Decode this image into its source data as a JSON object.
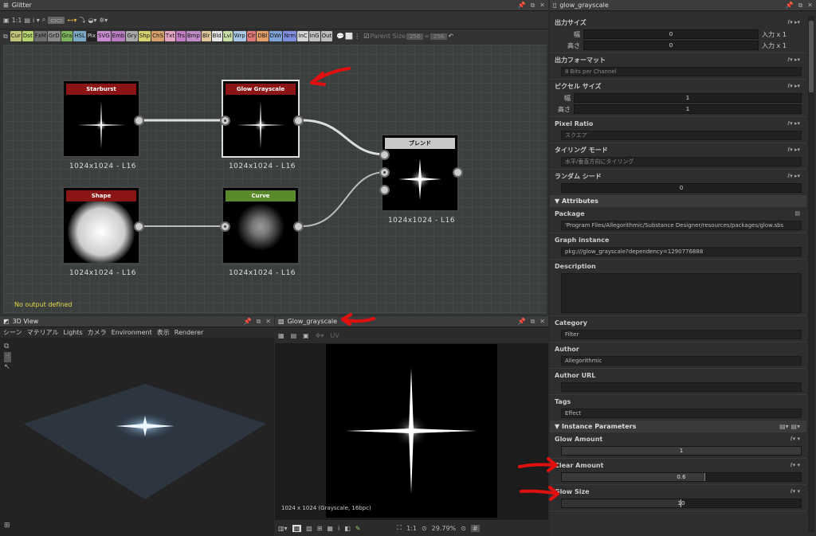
{
  "graph": {
    "title": "Glitter",
    "toolbar_zoom": "1:1",
    "library": [
      {
        "label": "Cur",
        "color": "#c3c37a"
      },
      {
        "label": "Dst",
        "color": "#b6d46e"
      },
      {
        "label": "FxM",
        "color": "#6e6e6e"
      },
      {
        "label": "GrD",
        "color": "#8a8a8a"
      },
      {
        "label": "Gra",
        "color": "#7db35c"
      },
      {
        "label": "HSL",
        "color": "#7aa9c5"
      },
      {
        "label": "Pix",
        "color": "#222"
      },
      {
        "label": "SVG",
        "color": "#c88bd0"
      },
      {
        "label": "Emb",
        "color": "#b97cc0"
      },
      {
        "label": "Gry",
        "color": "#a9a9a9"
      },
      {
        "label": "Shp",
        "color": "#d6d26e"
      },
      {
        "label": "ChS",
        "color": "#d5a06a"
      },
      {
        "label": "Txt",
        "color": "#e3a5c4"
      },
      {
        "label": "Trs",
        "color": "#c57cc6"
      },
      {
        "label": "Bmp",
        "color": "#c08ac6"
      },
      {
        "label": "Blr",
        "color": "#e0c79a"
      },
      {
        "label": "Bld",
        "color": "#e4e4e4"
      },
      {
        "label": "Lvl",
        "color": "#c7dfa5"
      },
      {
        "label": "Wrp",
        "color": "#a9c8e6"
      },
      {
        "label": "Clr",
        "color": "#e07878"
      },
      {
        "label": "DBl",
        "color": "#e39e6a"
      },
      {
        "label": "DWr",
        "color": "#7fa5d8"
      },
      {
        "label": "Nrm",
        "color": "#7f8ee0"
      },
      {
        "label": "InC",
        "color": "#d5d5d5"
      },
      {
        "label": "InG",
        "color": "#c0c0c0"
      },
      {
        "label": "Out",
        "color": "#bdbdbd"
      }
    ],
    "parent_size_label": "Parent Size",
    "parent_size_w": "256",
    "parent_size_h": "256",
    "no_output": "No output defined",
    "nodes": {
      "starburst": {
        "title": "Starburst",
        "cap": "1024x1024 - L16",
        "color": "#8b1515"
      },
      "glow": {
        "title": "Glow Grayscale",
        "cap": "1024x1024 - L16",
        "color": "#8b1515"
      },
      "blend": {
        "title": "ブレンド",
        "cap": "1024x1024 - L16",
        "color": "#c8c8c8"
      },
      "shape": {
        "title": "Shape",
        "cap": "1024x1024 - L16",
        "color": "#8b1515"
      },
      "curve": {
        "title": "Curve",
        "cap": "1024x1024 - L16",
        "color": "#5a8a2a"
      }
    }
  },
  "view3d": {
    "title": "3D View",
    "menu": [
      "シーン",
      "マテリアル",
      "Lights",
      "カメラ",
      "Environment",
      "表示",
      "Renderer"
    ]
  },
  "view2d": {
    "title": "Glow_grayscale",
    "uv": "UV",
    "info": "1024 x 1024 (Grayscale, 16bpc)",
    "zoom_ratio": "1:1",
    "zoom": "29.79%"
  },
  "props": {
    "title": "glow_grayscale",
    "output_size": {
      "label": "出力サイズ",
      "w_label": "幅",
      "h_label": "高さ",
      "w_val": "0",
      "h_val": "0",
      "suffix": "入力 x 1"
    },
    "output_format": {
      "label": "出力フォーマット",
      "value": "8 Bits per Channel"
    },
    "pixel_size": {
      "label": "ピクセル サイズ",
      "w_label": "幅",
      "h_label": "高さ",
      "w_val": "1",
      "h_val": "1"
    },
    "pixel_ratio": {
      "label": "Pixel Ratio",
      "value": "スクエア"
    },
    "tiling": {
      "label": "タイリング モード",
      "value": "水平/垂直方向にタイリング"
    },
    "random_seed": {
      "label": "ランダム シード",
      "value": "0"
    },
    "attributes_header": "Attributes",
    "package": {
      "label": "Package",
      "value": "'Program Files/Allegorithmic/Substance Designer/resources/packages/glow.sbs"
    },
    "graph_instance": {
      "label": "Graph instance",
      "value": "pkg:///glow_grayscale?dependency=1290776888"
    },
    "description": {
      "label": "Description"
    },
    "category": {
      "label": "Category",
      "value": "Filter"
    },
    "author": {
      "label": "Author",
      "value": "Allegorithmic"
    },
    "author_url": {
      "label": "Author URL",
      "value": ""
    },
    "tags": {
      "label": "Tags",
      "value": "Effect"
    },
    "instance_header": "Instance Parameters",
    "glow_amount": {
      "label": "Glow Amount",
      "value": "1",
      "fill": 1.0
    },
    "clear_amount": {
      "label": "Clear Amount",
      "value": "0.6",
      "fill": 0.6
    },
    "glow_size": {
      "label": "Glow Size",
      "value": "10",
      "fill": 0.5
    }
  },
  "colors": {
    "annotation": "#e01010"
  }
}
